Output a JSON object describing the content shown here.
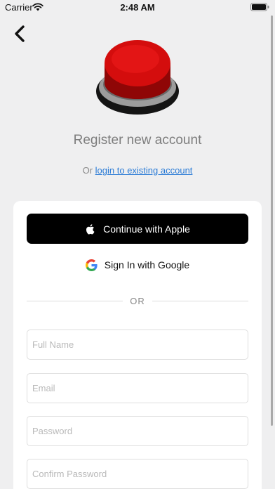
{
  "status_bar": {
    "carrier": "Carrier",
    "time": "2:48 AM"
  },
  "nav": {
    "back_icon": "chevron-left-icon"
  },
  "hero": {
    "icon": "red-button-icon",
    "title": "Register new account",
    "login_prefix": "Or",
    "login_link": "login to existing account"
  },
  "auth": {
    "apple_label": "Continue with Apple",
    "google_label": "Sign In with Google",
    "divider": "OR"
  },
  "form": {
    "full_name": {
      "placeholder": "Full Name",
      "value": ""
    },
    "email": {
      "placeholder": "Email",
      "value": ""
    },
    "password": {
      "placeholder": "Password",
      "value": ""
    },
    "confirm_password": {
      "placeholder": "Confirm Password",
      "value": ""
    }
  },
  "colors": {
    "background": "#efeff0",
    "link": "#2a7bd6",
    "button_red": "#d40d0d"
  }
}
